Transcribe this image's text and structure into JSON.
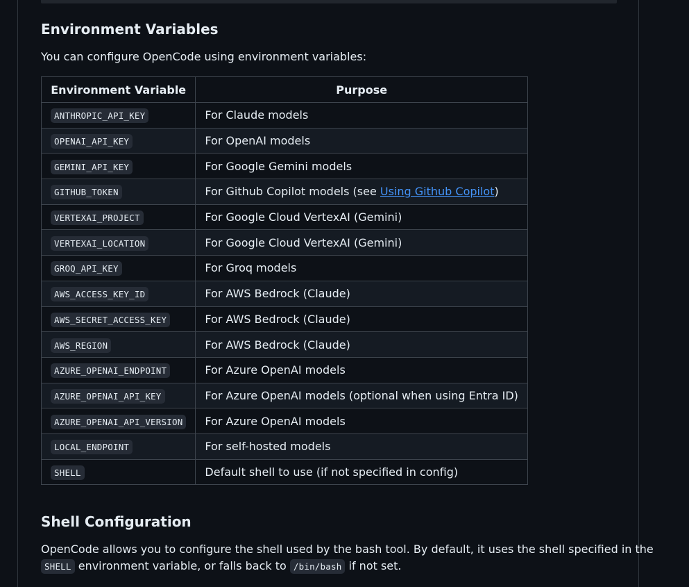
{
  "env_section": {
    "heading": "Environment Variables",
    "intro": "You can configure OpenCode using environment variables:",
    "table": {
      "headers": [
        "Environment Variable",
        "Purpose"
      ],
      "rows": [
        {
          "variable": "ANTHROPIC_API_KEY",
          "purpose": "For Claude models"
        },
        {
          "variable": "OPENAI_API_KEY",
          "purpose": "For OpenAI models"
        },
        {
          "variable": "GEMINI_API_KEY",
          "purpose": "For Google Gemini models"
        },
        {
          "variable": "GITHUB_TOKEN",
          "purpose_prefix": "For Github Copilot models (see ",
          "link_text": "Using Github Copilot",
          "purpose_suffix": ")"
        },
        {
          "variable": "VERTEXAI_PROJECT",
          "purpose": "For Google Cloud VertexAI (Gemini)"
        },
        {
          "variable": "VERTEXAI_LOCATION",
          "purpose": "For Google Cloud VertexAI (Gemini)"
        },
        {
          "variable": "GROQ_API_KEY",
          "purpose": "For Groq models"
        },
        {
          "variable": "AWS_ACCESS_KEY_ID",
          "purpose": "For AWS Bedrock (Claude)"
        },
        {
          "variable": "AWS_SECRET_ACCESS_KEY",
          "purpose": "For AWS Bedrock (Claude)"
        },
        {
          "variable": "AWS_REGION",
          "purpose": "For AWS Bedrock (Claude)"
        },
        {
          "variable": "AZURE_OPENAI_ENDPOINT",
          "purpose": "For Azure OpenAI models"
        },
        {
          "variable": "AZURE_OPENAI_API_KEY",
          "purpose": "For Azure OpenAI models (optional when using Entra ID)"
        },
        {
          "variable": "AZURE_OPENAI_API_VERSION",
          "purpose": "For Azure OpenAI models"
        },
        {
          "variable": "LOCAL_ENDPOINT",
          "purpose": "For self-hosted models"
        },
        {
          "variable": "SHELL",
          "purpose": "Default shell to use (if not specified in config)"
        }
      ]
    }
  },
  "shell_section": {
    "heading": "Shell Configuration",
    "line1": "OpenCode allows you to configure the shell used by the bash tool. By default, it uses the shell specified in the",
    "code_shell": "SHELL",
    "line2_mid": " environment variable, or falls back to ",
    "code_bash": "/bin/bash",
    "line2_end": " if not set."
  },
  "colors": {
    "background": "#0d1117",
    "text": "#e6edf3",
    "border": "#3d444d",
    "code_bg": "#262c36",
    "link": "#4493f8",
    "striped_row": "#151b23"
  }
}
